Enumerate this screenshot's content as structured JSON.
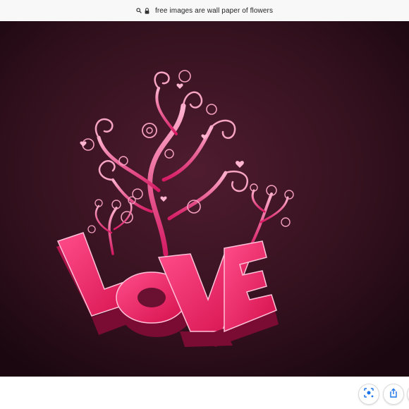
{
  "browser": {
    "address_text": "free images are wall paper of flowers",
    "icons": [
      "search-icon",
      "lock-icon"
    ]
  },
  "image": {
    "word": "LOVE",
    "colors": {
      "background_center": "#4a1a2b",
      "background_edge": "#1a0710",
      "letter_front": "#e8185a",
      "letter_side": "#a8104a",
      "swirl": "#ff9ec4",
      "branch": "#e2457f"
    }
  },
  "toolbar": {
    "buttons": [
      "lens-search-icon",
      "share-icon"
    ]
  }
}
